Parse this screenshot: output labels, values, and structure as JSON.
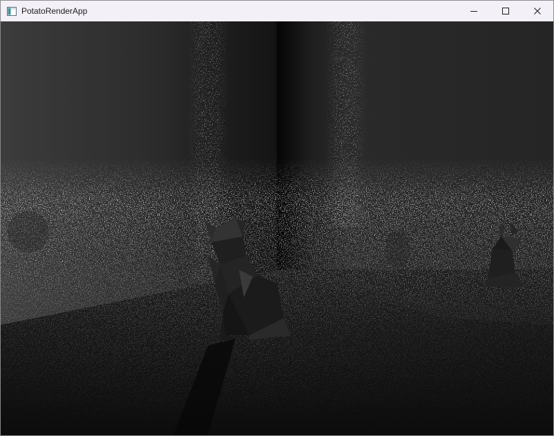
{
  "window": {
    "title": "PotatoRenderApp",
    "app_icon": "window-app-icon",
    "controls": [
      {
        "name": "minimize-button",
        "icon": "minimize-icon"
      },
      {
        "name": "maximize-button",
        "icon": "maximize-icon"
      },
      {
        "name": "close-button",
        "icon": "close-icon"
      }
    ]
  },
  "render": {
    "description_colors": {
      "wall_left": "#3a3a3a",
      "wall_right": "#242424",
      "floor": "#121212",
      "noise": "#d0d0d0"
    }
  }
}
